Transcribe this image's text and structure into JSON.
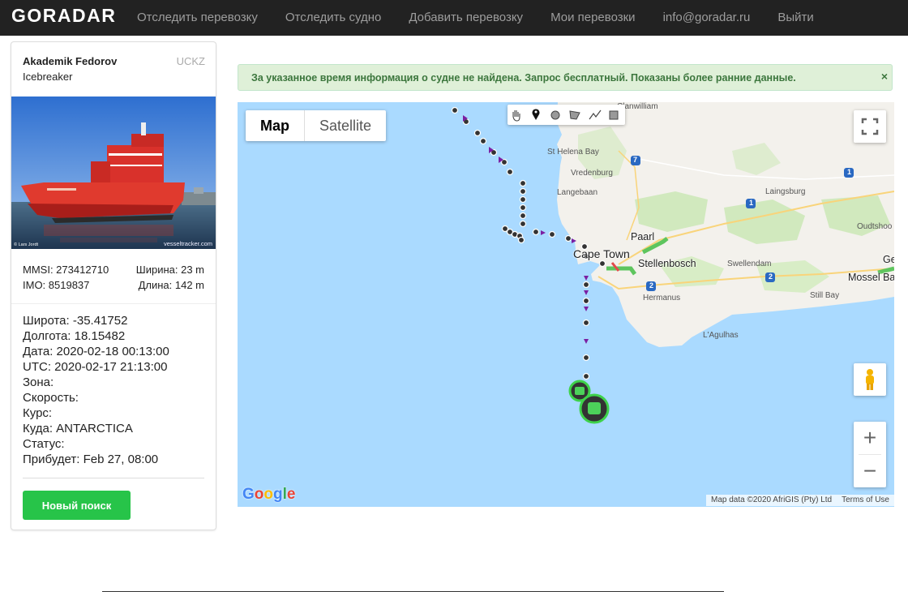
{
  "brand": {
    "logo": "GORADAR"
  },
  "nav": {
    "items": [
      "Отследить перевозку",
      "Отследить судно",
      "Добавить перевозку",
      "Мои перевозки",
      "info@goradar.ru",
      "Выйти"
    ]
  },
  "vessel": {
    "name": "Akademik Fedorov",
    "callsign": "UCKZ",
    "type": "Icebreaker",
    "photo_credit": "© Lars Jordt",
    "photo_source": "vesseltracker.com",
    "mmsi": "MMSI: 273412710",
    "width": "Ширина: 23 m",
    "imo": "IMO: 8519837",
    "length": "Длина: 142 m"
  },
  "info": {
    "lat": "Широта: -35.41752",
    "lon": "Долгота: 18.15482",
    "date": "Дата: 2020-02-18 00:13:00",
    "utc": "UTC: 2020-02-17 21:13:00",
    "zone": "Зона:",
    "speed": "Скорость:",
    "course": "Курс:",
    "dest": "Куда: ANTARCTICA",
    "status": "Статус:",
    "eta": "Прибудет: Feb 27, 08:00"
  },
  "buttons": {
    "new_search": "Новый поиск"
  },
  "alert": {
    "text": "За указанное время информация о судне не найдена. Запрос бесплатный. Показаны более ранние данные.",
    "close": "×"
  },
  "map": {
    "type_map": "Map",
    "type_satellite": "Satellite",
    "google": "Google",
    "attribution": "Map data ©2020 AfriGIS (Pty) Ltd",
    "terms": "Terms of Use",
    "zoom_in": "+",
    "zoom_out": "−",
    "labels": {
      "clanwilliam": "Clanwilliam",
      "st_helena_bay": "St Helena Bay",
      "vredenburg": "Vredenburg",
      "langebaan": "Langebaan",
      "laingsburg": "Laingsburg",
      "oudtshoorn": "Oudtshoo",
      "paarl": "Paarl",
      "cape_town": "Cape Town",
      "stellenbosch": "Stellenbosch",
      "swellendam": "Swellendam",
      "mossel_bay": "Mossel Ba",
      "ge": "Ge",
      "hermanus": "Hermanus",
      "still_bay": "Still Bay",
      "l_agulhas": "L'Agulhas"
    },
    "route_markers": {
      "n7": "7",
      "n1a": "1",
      "n1b": "1",
      "n2a": "2",
      "n2b": "2"
    }
  },
  "colors": {
    "accent_green": "#27c449",
    "alert_bg": "#dff0d8",
    "alert_text": "#3c763d",
    "navbar": "#222222",
    "sea": "#aadaff"
  }
}
